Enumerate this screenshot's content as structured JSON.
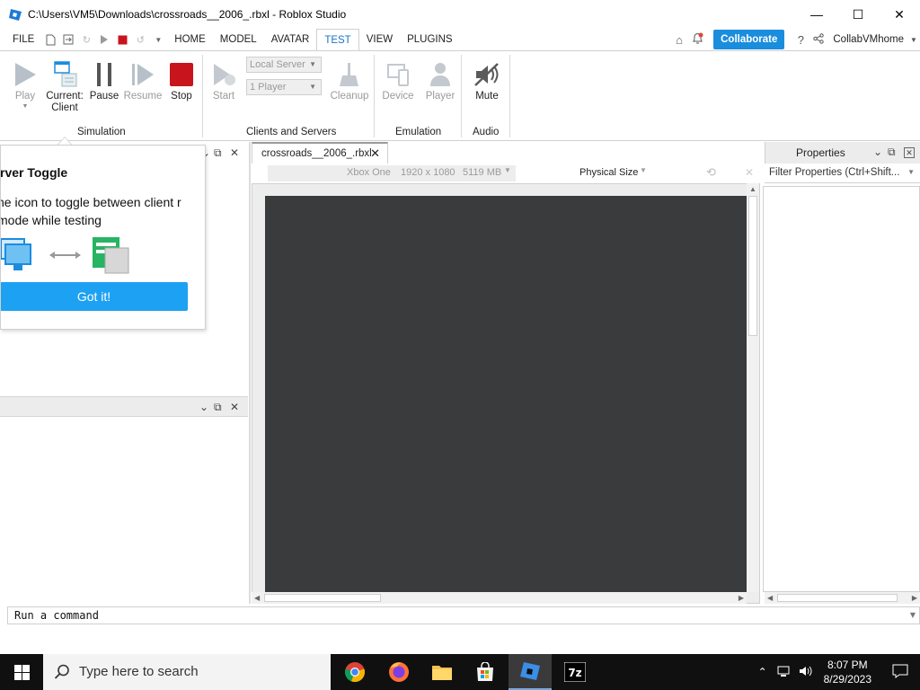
{
  "window": {
    "title": "C:\\Users\\VM5\\Downloads\\crossroads__2006_.rbxl - Roblox Studio",
    "minimize": "—",
    "maximize": "☐",
    "close": "✕"
  },
  "menu": {
    "file": "FILE",
    "tabs": [
      "HOME",
      "MODEL",
      "AVATAR",
      "TEST",
      "VIEW",
      "PLUGINS"
    ],
    "active_tab": "TEST",
    "collaborate": "Collaborate",
    "user": "CollabVMhome"
  },
  "ribbon": {
    "simulation": {
      "label": "Simulation",
      "play": "Play",
      "current_line1": "Current:",
      "current_line2": "Client",
      "pause": "Pause",
      "resume": "Resume",
      "stop": "Stop"
    },
    "clients_servers": {
      "label": "Clients and Servers",
      "start": "Start",
      "server_select": "Local Server",
      "players_select": "1 Player",
      "cleanup": "Cleanup"
    },
    "emulation": {
      "label": "Emulation",
      "device": "Device",
      "player": "Player"
    },
    "audio": {
      "label": "Audio",
      "mute": "Mute"
    }
  },
  "tooltip": {
    "title": "rver Toggle",
    "body": "he icon to toggle between client r mode while testing",
    "button": "Got it!"
  },
  "document": {
    "tab": "crossroads__2006_.rbxl",
    "device": "Xbox One",
    "resolution": "1920 x 1080",
    "memory": "5119 MB",
    "size_mode": "Physical Size"
  },
  "properties": {
    "title": "Properties",
    "filter_placeholder": "Filter Properties (Ctrl+Shift..."
  },
  "command": {
    "placeholder": "Run a command"
  },
  "taskbar": {
    "search": "Type here to search",
    "time": "8:07 PM",
    "date": "8/29/2023"
  },
  "colors": {
    "accent": "#1b8ddd",
    "got_it": "#1da1f2",
    "stop": "#c8141c",
    "viewport": "#3a3b3c"
  }
}
